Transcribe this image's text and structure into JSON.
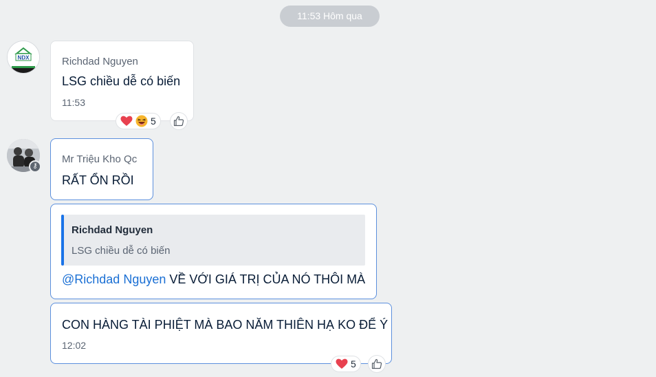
{
  "time_separator": "11:53 Hôm qua",
  "messages": [
    {
      "sender": "Richdad Nguyen",
      "text": "LSG chiều dễ có biến",
      "time": "11:53",
      "avatar_text": "NDX",
      "reactions": {
        "icons": [
          "heart-icon",
          "laugh-emoji-icon"
        ],
        "count": "5"
      }
    },
    {
      "sender": "Mr Triệu Kho Qc",
      "text": "RẤT ỔN RỒI"
    },
    {
      "quote": {
        "name": "Richdad Nguyen",
        "text": "LSG chiều dễ có biến"
      },
      "mention": "@Richdad Nguyen",
      "text": " VỀ VỚI GIÁ TRỊ CỦA NÓ THÔI MÀ"
    },
    {
      "text": "CON HÀNG TÀI PHIỆT MÀ BAO NĂM THIÊN HẠ KO ĐỂ Ý",
      "time": "12:02",
      "reactions": {
        "icons": [
          "heart-icon"
        ],
        "count": "5"
      }
    }
  ],
  "colors": {
    "background": "#eef0f1",
    "selected_border": "#5b8fdd",
    "mention": "#1a6fd4",
    "quote_bar": "#1a73e8",
    "heart": "#e8414f"
  }
}
